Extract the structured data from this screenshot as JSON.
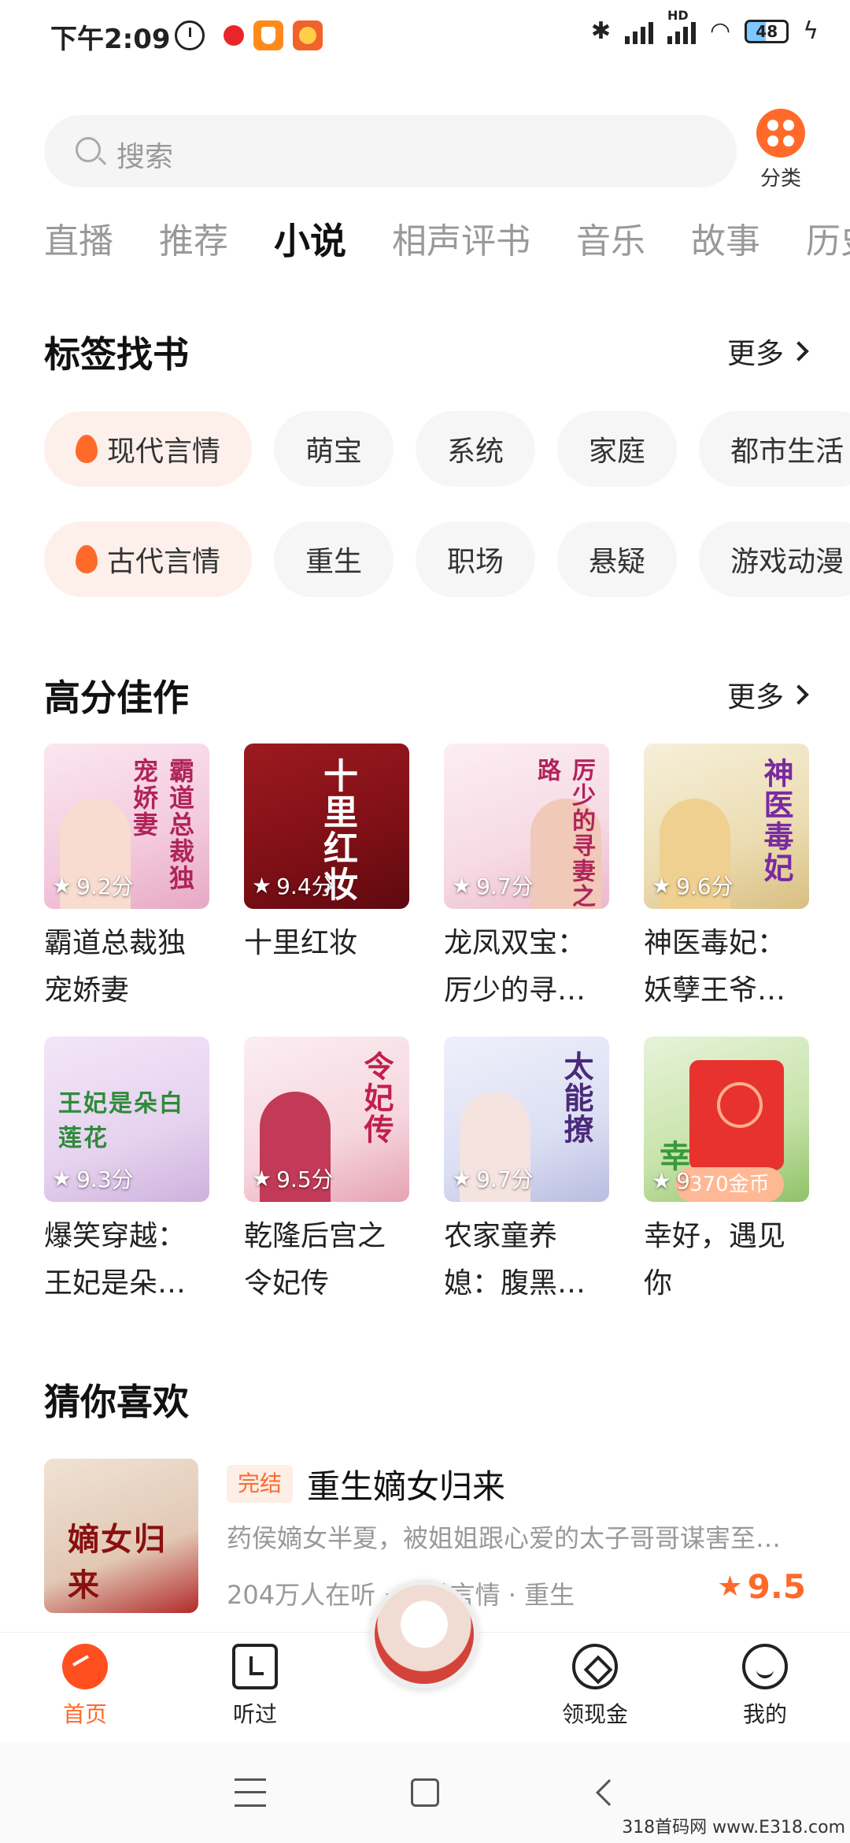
{
  "status_bar": {
    "time": "下午2:09",
    "bluetooth": "✱",
    "network": "HD",
    "battery": "48"
  },
  "search": {
    "placeholder": "搜索"
  },
  "category": {
    "label": "分类"
  },
  "tabs": [
    "直播",
    "推荐",
    "小说",
    "相声评书",
    "音乐",
    "故事",
    "历史"
  ],
  "active_tab": "小说",
  "tag_section": {
    "title": "标签找书",
    "more": "更多",
    "row1": [
      "现代言情",
      "萌宝",
      "系统",
      "家庭",
      "都市生活"
    ],
    "row2": [
      "古代言情",
      "重生",
      "职场",
      "悬疑",
      "游戏动漫"
    ]
  },
  "high_score": {
    "title": "高分佳作",
    "more": "更多",
    "books": [
      {
        "title": "霸道总裁独宠娇妻",
        "score": "9.2分",
        "cover_text": "霸道总裁独宠娇妻"
      },
      {
        "title": "十里红妆",
        "score": "9.4分",
        "cover_text": "十里红妆"
      },
      {
        "title": "龙凤双宝：厉少的寻…",
        "score": "9.7分",
        "cover_text": "厉少的寻妻之路"
      },
      {
        "title": "神医毒妃：妖孽王爷…",
        "score": "9.6分",
        "cover_text": "神医毒妃"
      },
      {
        "title": "爆笑穿越：王妃是朵…",
        "score": "9.3分",
        "cover_text": "王妃是朵白莲花"
      },
      {
        "title": "乾隆后宫之令妃传",
        "score": "9.5分",
        "cover_text": "令妃传"
      },
      {
        "title": "农家童养媳：腹黑…",
        "score": "9.7分",
        "cover_text": "太能撩"
      },
      {
        "title": "幸好，遇见你",
        "score": "9",
        "cover_text": "幸",
        "coin_badge": "370金币"
      }
    ]
  },
  "guess": {
    "title": "猜你喜欢",
    "item": {
      "badge": "完结",
      "title": "重生嫡女归来",
      "desc": "药侯嫡女半夏，被姐姐跟心爱的太子哥哥谋害至…",
      "meta": "204万人在听 · 古代言情 · 重生",
      "score": "9.5",
      "cover_text": "嫡女归来"
    }
  },
  "bottom_nav": {
    "home": "首页",
    "history": "听过",
    "cash": "领现金",
    "me": "我的"
  },
  "watermark": "318首码网 www.E318.com",
  "colors": {
    "accent": "#ff6a2b"
  }
}
